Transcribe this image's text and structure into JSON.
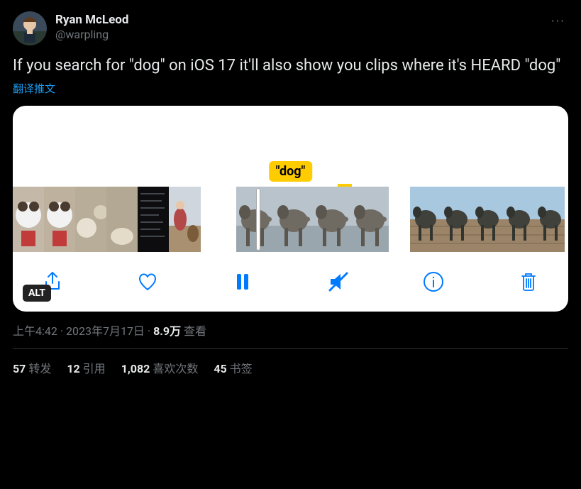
{
  "author": {
    "display_name": "Ryan McLeod",
    "handle": "@warpling"
  },
  "tweet": {
    "text": "If you search for \"dog\" on iOS 17 it'll also show you clips where it's HEARD \"dog\"",
    "translate_label": "翻译推文"
  },
  "media": {
    "badge_text": "\"dog\"",
    "alt_label": "ALT"
  },
  "meta": {
    "time": "上午4:42",
    "date": "2023年7月17日",
    "views_count": "8.9万",
    "views_label": "查看"
  },
  "counts": {
    "retweets_n": "57",
    "retweets_label": "转发",
    "quotes_n": "12",
    "quotes_label": "引用",
    "likes_n": "1,082",
    "likes_label": "喜欢次数",
    "bookmarks_n": "45",
    "bookmarks_label": "书签"
  }
}
